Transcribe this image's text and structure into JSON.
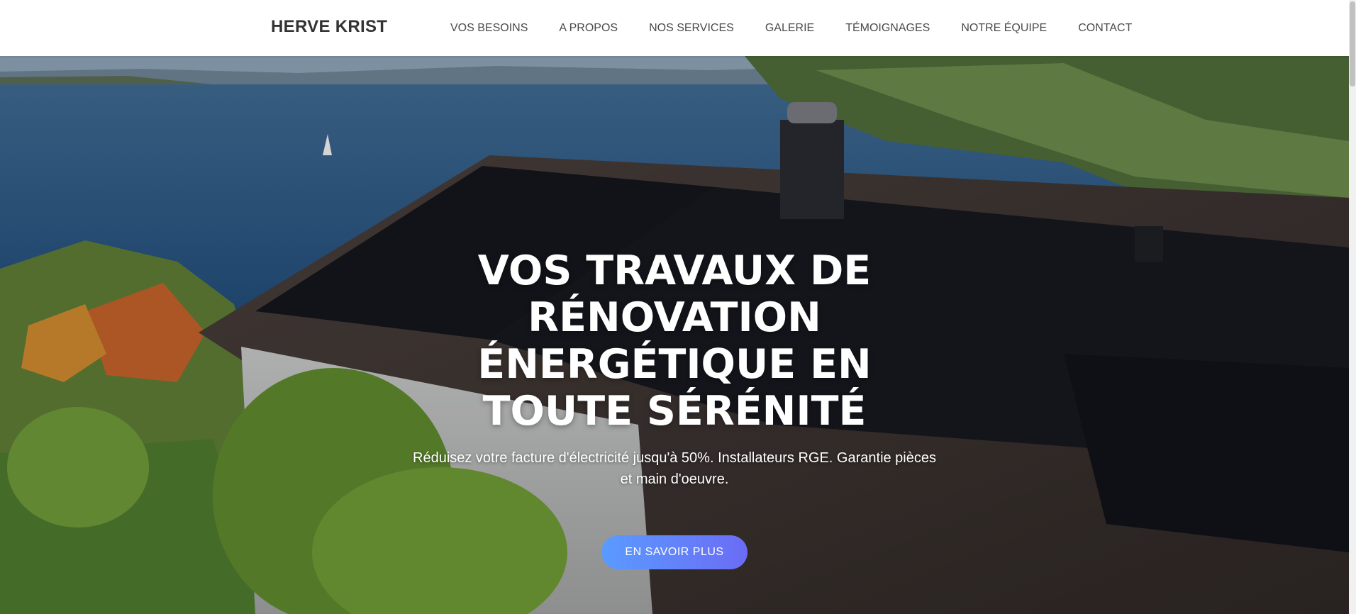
{
  "brand": {
    "name": "HERVE KRIST"
  },
  "nav": {
    "items": [
      {
        "label": "VOS BESOINS"
      },
      {
        "label": "A PROPOS"
      },
      {
        "label": "NOS SERVICES"
      },
      {
        "label": "GALERIE"
      },
      {
        "label": "TÉMOIGNAGES"
      },
      {
        "label": "NOTRE ÉQUIPE"
      },
      {
        "label": "CONTACT"
      }
    ]
  },
  "hero": {
    "title": "VOS TRAVAUX DE RÉNOVATION ÉNERGÉTIQUE EN TOUTE SÉRÉNITÉ",
    "subtitle": "Réduisez votre facture d'électricité jusqu'à 50%. Installateurs RGE. Garantie pièces et main d'oeuvre.",
    "cta_label": "EN SAVOIR PLUS"
  },
  "colors": {
    "accent_gradient_start": "#5a9bff",
    "accent_gradient_end": "#6b6cf5",
    "nav_text": "#4a4a4a",
    "brand_text": "#333333"
  }
}
